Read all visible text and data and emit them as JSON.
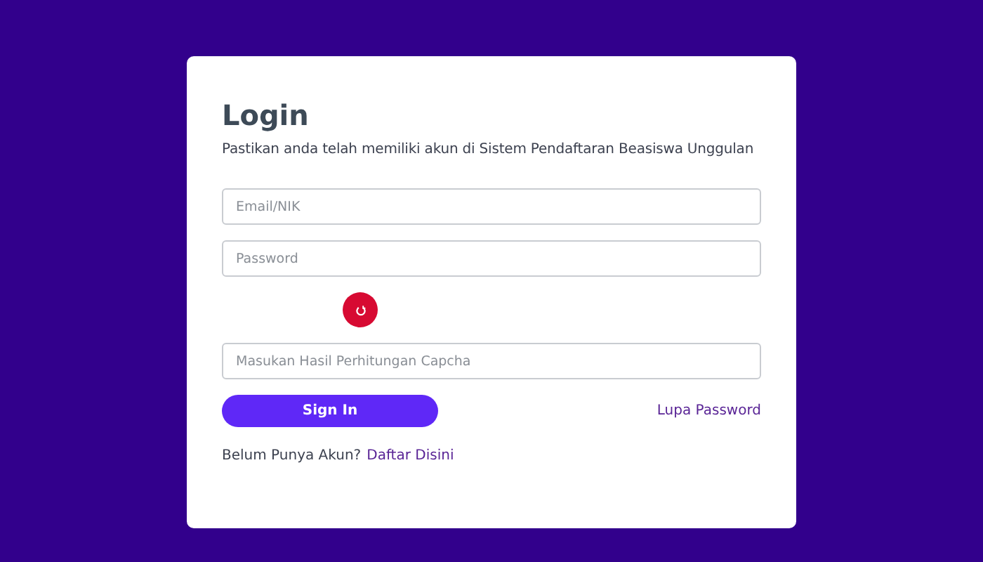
{
  "title": "Login",
  "subtitle": "Pastikan anda telah memiliki akun di Sistem Pendaftaran Beasiswa Unggulan",
  "fields": [
    {
      "placeholder": "Email/NIK"
    },
    {
      "placeholder": "Password"
    }
  ],
  "captcha_field": {
    "placeholder": "Masukan Hasil Perhitungan Capcha"
  },
  "sign_in": "Sign In",
  "forgot": "Lupa Password",
  "register_prompt": "Belum Punya Akun?",
  "register_link": "Daftar Disini"
}
